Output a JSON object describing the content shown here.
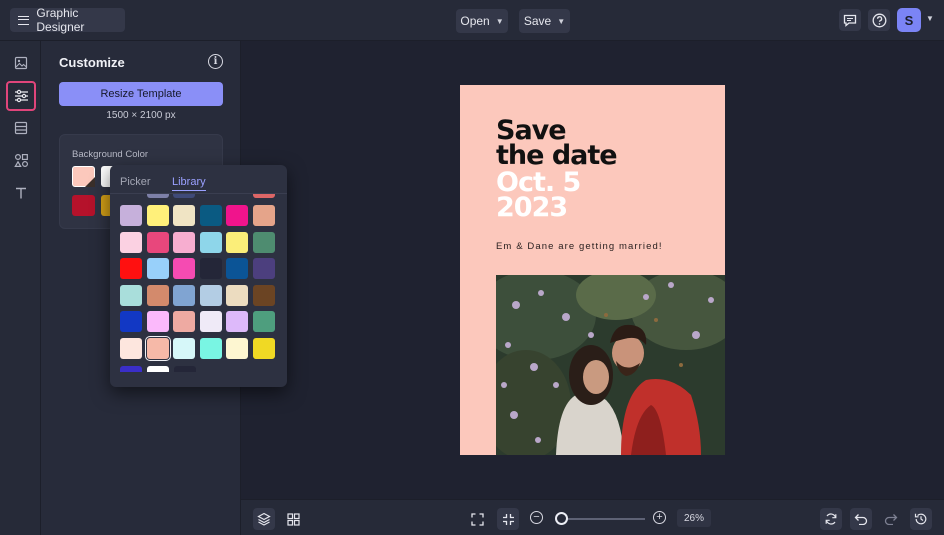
{
  "app": {
    "title": "Graphic Designer"
  },
  "topbar": {
    "open_label": "Open",
    "save_label": "Save",
    "avatar_initial": "S"
  },
  "panel": {
    "title": "Customize",
    "resize_label": "Resize Template",
    "dimensions": "1500 × 2100 px",
    "background_color_label": "Background Color",
    "bg_swatches": [
      "#fcc8bc",
      "#ffffff",
      "#b5122b",
      "#d4a017"
    ]
  },
  "color_popover": {
    "tabs": [
      "Picker",
      "Library"
    ],
    "active_tab": "Library",
    "selected_color": "#f6b9a8",
    "palette": [
      [
        "#c6b0db",
        "#fff07a",
        "#f0e4c4",
        "#0a5a82",
        "#f0148c",
        "#e5a48a"
      ],
      [
        "#fbd1e2",
        "#e8477c",
        "#f7aed0",
        "#8ed6ea",
        "#fbee79",
        "#4e8c70"
      ],
      [
        "#ff1010",
        "#98d0fa",
        "#f54bb2",
        "#242638",
        "#0b5496",
        "#4c3f7e"
      ],
      [
        "#a9dedb",
        "#d38a6c",
        "#80a4d2",
        "#b3cde4",
        "#ecdcc0",
        "#6b4423"
      ],
      [
        "#1238c4",
        "#fbb9fb",
        "#eeaaa2",
        "#efeaf7",
        "#ddb9fa",
        "#4e9e7e"
      ],
      [
        "#fde6de",
        "#f6b9a8",
        "#d6f7f9",
        "#79f5e3",
        "#fdf6d1",
        "#f0d924"
      ]
    ]
  },
  "artboard": {
    "headline_1": "Save",
    "headline_2": "the date",
    "date_1": "Oct. 5",
    "date_2": "2023",
    "subtitle": "Em & Dane are getting married!",
    "background": "#fcc8bc"
  },
  "bottombar": {
    "zoom": "26%",
    "zoom_fraction": 0.05
  }
}
